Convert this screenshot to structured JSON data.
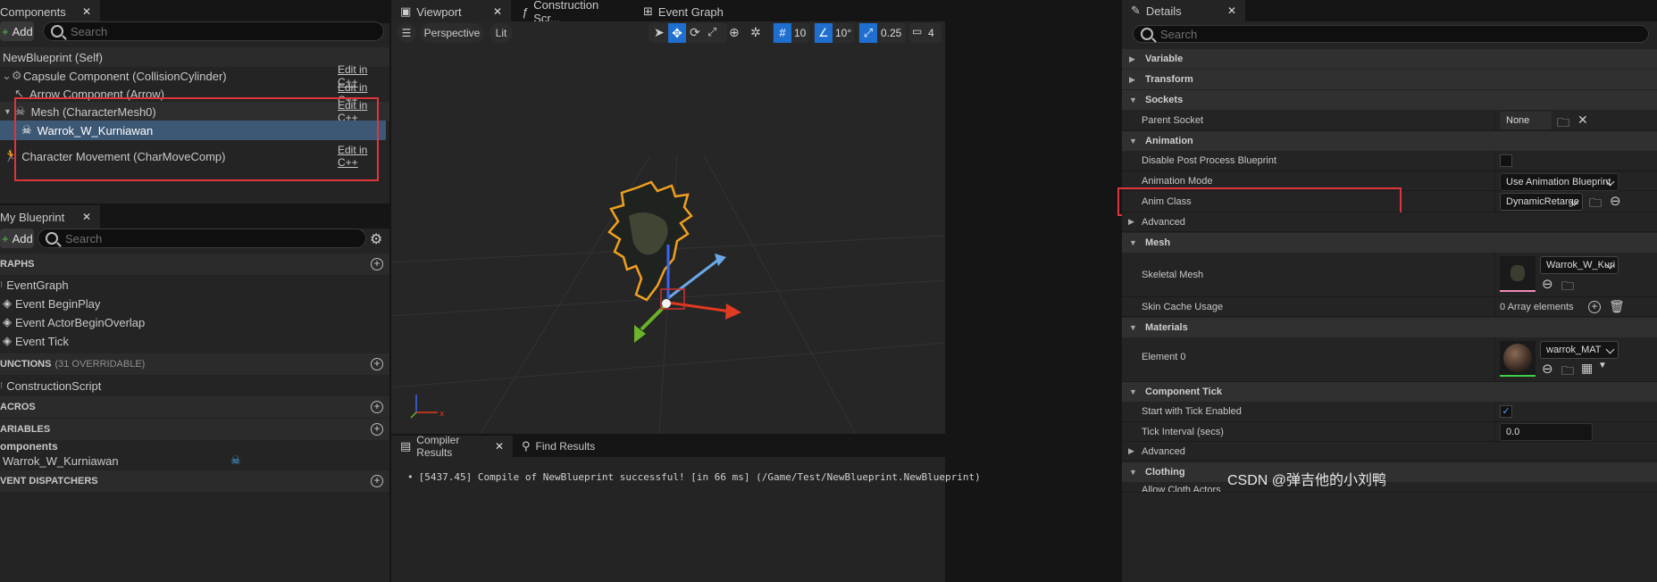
{
  "components_panel": {
    "tab_label": "Components",
    "add_label": "Add",
    "search_placeholder": "Search",
    "self_label": "NewBlueprint (Self)",
    "items": [
      {
        "label": "Capsule Component (CollisionCylinder)",
        "action": "Edit in C++"
      },
      {
        "label": "Arrow Component (Arrow)",
        "action": "Edit in C++"
      },
      {
        "label": "Mesh (CharacterMesh0)",
        "action": "Edit in C++"
      },
      {
        "label": "Warrok_W_Kurniawan",
        "action": ""
      },
      {
        "label": "Character Movement (CharMoveComp)",
        "action": "Edit in C++"
      }
    ]
  },
  "my_blueprint": {
    "tab_label": "My Blueprint",
    "add_label": "Add",
    "search_placeholder": "Search",
    "graphs_header": "RAPHS",
    "graphs": [
      "EventGraph",
      "Event BeginPlay",
      "Event ActorBeginOverlap",
      "Event Tick"
    ],
    "functions_header": "UNCTIONS",
    "functions_count": "(31 OVERRIDABLE)",
    "functions": [
      "ConstructionScript"
    ],
    "macros_header": "ACROS",
    "variables_header": "ARIABLES",
    "var_group": "omponents",
    "var_item": "Warrok_W_Kurniawan",
    "dispatchers_header": "VENT DISPATCHERS"
  },
  "center_tabs": {
    "viewport": "Viewport",
    "construction": "Construction Scr...",
    "event_graph": "Event Graph"
  },
  "viewport_toolbar": {
    "perspective": "Perspective",
    "lit": "Lit",
    "grid_snap": "10",
    "rot_snap": "10°",
    "scale_snap": "0.25",
    "cam_speed": "4"
  },
  "bottom_panel": {
    "compiler_tab": "Compiler Results",
    "find_tab": "Find Results",
    "message": "[5437.45] Compile of NewBlueprint successful! [in 66 ms] (/Game/Test/NewBlueprint.NewBlueprint)"
  },
  "details": {
    "tab_label": "Details",
    "search_placeholder": "Search",
    "cat_variable": "Variable",
    "cat_transform": "Transform",
    "cat_sockets": "Sockets",
    "parent_socket_label": "Parent Socket",
    "parent_socket_value": "None",
    "cat_animation": "Animation",
    "disable_pp_label": "Disable Post Process Blueprint",
    "anim_mode_label": "Animation Mode",
    "anim_mode_value": "Use Animation Blueprint",
    "anim_class_label": "Anim Class",
    "anim_class_value": "DynamicRetarge",
    "advanced_label": "Advanced",
    "cat_mesh": "Mesh",
    "skeletal_mesh_label": "Skeletal Mesh",
    "skeletal_mesh_value": "Warrok_W_Kuri",
    "skin_cache_label": "Skin Cache Usage",
    "skin_cache_value": "0 Array elements",
    "cat_materials": "Materials",
    "element0_label": "Element 0",
    "element0_value": "warrok_MAT",
    "cat_component_tick": "Component Tick",
    "start_tick_label": "Start with Tick Enabled",
    "tick_interval_label": "Tick Interval (secs)",
    "tick_interval_value": "0.0",
    "advanced2_label": "Advanced",
    "cat_clothing": "Clothing",
    "allow_cloth_label": "Allow Cloth Actors"
  },
  "watermark": "CSDN @弹吉他的小刘鸭",
  "colors": {
    "highlight_box": "#e0343a",
    "selected_row": "#3d5875",
    "accent_blue": "#1f6fd1",
    "checkbox": "#1f6fd1"
  }
}
